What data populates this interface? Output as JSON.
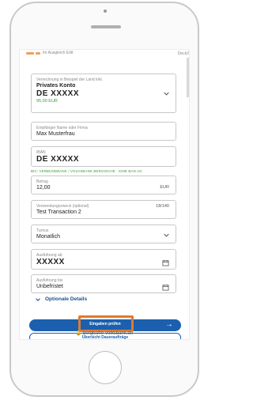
{
  "topbar": {
    "text": "Im Ausgleich Edit",
    "right": "Deck2"
  },
  "account": {
    "label": "Verrechnung in Beispiel der Land inkl.",
    "name": "Privates Konto",
    "iban": "DE XXXXX",
    "balance": "95,00 EUR"
  },
  "recipient": {
    "label": "Empfänger Name oder Firma",
    "value": "Max Musterfrau"
  },
  "iban": {
    "label": "IBAN",
    "value": "DE XXXXX"
  },
  "green_hint": "BIC: VERBUNDBANK / VOLKSBANK BERGISCHE · KNIE BAN AG",
  "amount": {
    "label": "Betrag",
    "value": "12,00",
    "currency": "EUR"
  },
  "purpose": {
    "label": "Verwendungszweck (optional)",
    "value": "Test Transaction 2",
    "counter": "18/140"
  },
  "interval": {
    "label": "Turnus",
    "value": "Monatlich"
  },
  "start": {
    "label": "Ausführung ab",
    "value": "XXXXX"
  },
  "end": {
    "label": "Ausführung bis",
    "value": "Unbefristet"
  },
  "optional_label": "Optionale Details",
  "primary_button": "Eingaben prüfen",
  "secondary_button": "Übersicht Daueraufträge",
  "url": "bergische-volksbank.de",
  "colors": {
    "accent": "#1b5fae",
    "highlight": "#e07a2e",
    "hint": "#3a9b3a"
  }
}
